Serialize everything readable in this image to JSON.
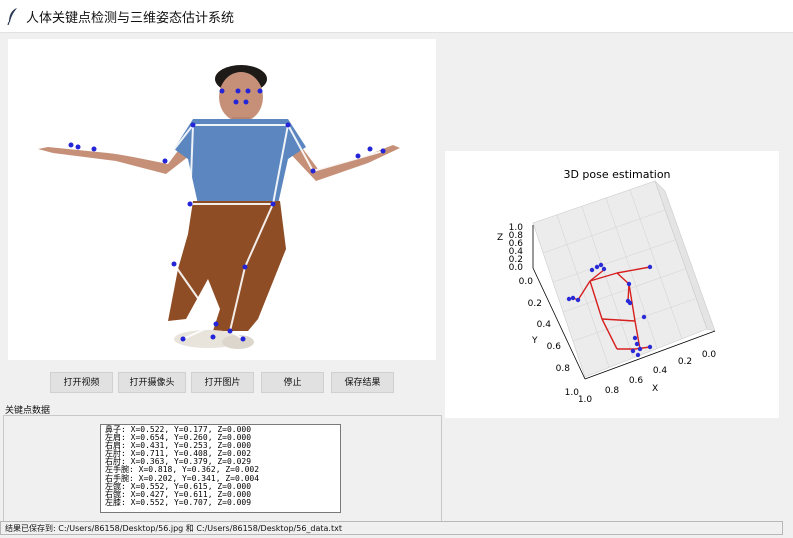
{
  "window": {
    "title": "人体关键点检测与三维姿态估计系统",
    "icon": "feather-icon"
  },
  "buttons": [
    {
      "label": "打开视频"
    },
    {
      "label": "打开摄像头"
    },
    {
      "label": "打开图片"
    },
    {
      "label": "停止"
    },
    {
      "label": "保存结果"
    }
  ],
  "keypoints_section": {
    "label": "关键点数据",
    "rows": [
      {
        "name": "鼻子",
        "text": "鼻子: X=0.522, Y=0.177, Z=0.000"
      },
      {
        "name": "左肩",
        "text": "左肩: X=0.654, Y=0.260, Z=0.000"
      },
      {
        "name": "右肩",
        "text": "右肩: X=0.431, Y=0.253, Z=0.000"
      },
      {
        "name": "左肘",
        "text": "左肘: X=0.711, Y=0.408, Z=0.002"
      },
      {
        "name": "右肘",
        "text": "右肘: X=0.363, Y=0.379, Z=0.029"
      },
      {
        "name": "左手腕",
        "text": "左手腕: X=0.818, Y=0.362, Z=0.002"
      },
      {
        "name": "右手腕",
        "text": "右手腕: X=0.202, Y=0.341, Z=0.004"
      },
      {
        "name": "左髋",
        "text": "左髋: X=0.552, Y=0.615, Z=0.000"
      },
      {
        "name": "右髋",
        "text": "右髋: X=0.427, Y=0.611, Z=0.000"
      },
      {
        "name": "左膝",
        "text": "左膝: X=0.552, Y=0.707, Z=0.009"
      }
    ]
  },
  "plot3d": {
    "title": "3D pose estimation",
    "x_label": "X",
    "y_label": "Y",
    "z_label": "Z",
    "z_ticks": [
      "1.0",
      "0.8",
      "0.6",
      "0.4",
      "0.2",
      "0.0"
    ],
    "y_ticks": [
      "0.0",
      "0.2",
      "0.4",
      "0.6",
      "0.8",
      "1.0"
    ],
    "x_ticks": [
      "1.0",
      "0.8",
      "0.6",
      "0.4",
      "0.2",
      "0.0"
    ],
    "bone_color": "#d62020",
    "joint_color": "#2a2ad6"
  },
  "status": {
    "text": "结果已保存到: C:/Users/86158/Desktop/56.jpg 和 C:/Users/86158/Desktop/56_data.txt"
  }
}
